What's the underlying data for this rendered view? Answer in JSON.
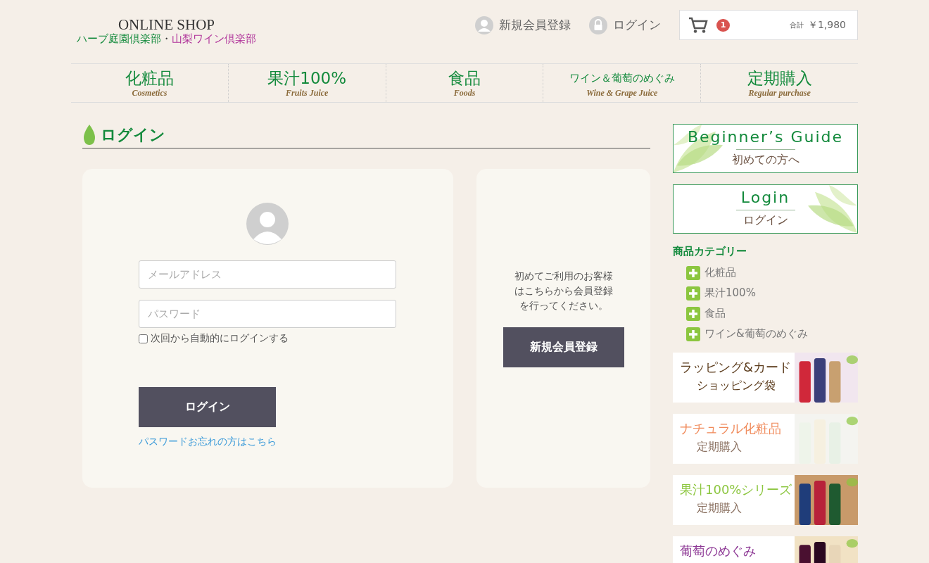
{
  "header": {
    "logo": "ONLINE SHOP",
    "clubs": [
      {
        "label": "ハーブ庭園倶楽部",
        "kind": "herb"
      },
      {
        "label": "・",
        "kind": "dot"
      },
      {
        "label": "山梨ワイン倶楽部",
        "kind": "wine"
      }
    ],
    "register_link": "新規会員登録",
    "login_link": "ログイン",
    "cart": {
      "count": "1",
      "total_label": "合計",
      "total": "￥1,980"
    }
  },
  "nav": [
    {
      "label": "化粧品",
      "sub": "Cosmetics"
    },
    {
      "label": "果汁100%",
      "sub": "Fruits Juice"
    },
    {
      "label": "食品",
      "sub": "Foods"
    },
    {
      "label": "ワイン＆葡萄のめぐみ",
      "sub": "Wine & Grape Juice"
    },
    {
      "label": "定期購入",
      "sub": "Regular purchase"
    }
  ],
  "page_title": "ログイン",
  "login_form": {
    "email": {
      "placeholder": "メールアドレス"
    },
    "password": {
      "placeholder": "パスワード"
    },
    "remember": {
      "label": "次回から自動的にログインする",
      "checked": false
    },
    "submit": "ログイン",
    "forgot_link": "パスワードお忘れの方はこちら"
  },
  "register_box": {
    "message": [
      "初めてご利用のお客様",
      "はこちらから会員登録",
      "を行ってください。"
    ],
    "button": "新規会員登録"
  },
  "sidebar": {
    "guide_banners": [
      {
        "title": "Beginner’s Guide",
        "subtitle": "初めての方へ",
        "kind": "leaf-left"
      },
      {
        "title": "Login",
        "subtitle": "ログイン",
        "kind": "leaf-right"
      }
    ],
    "category_heading": "商品カテゴリー",
    "categories": [
      "化粧品",
      "果汁100%",
      "食品",
      "ワイン&葡萄のめぐみ"
    ],
    "promo_banners": [
      {
        "lines": [
          "ラッピング&カード",
          "ショッピング袋"
        ],
        "kind": "wrapping"
      },
      {
        "lines": [
          "ナチュラル化粧品",
          "定期購入"
        ],
        "kind": "cosmetics"
      },
      {
        "lines": [
          "果汁100%シリーズ",
          "定期購入"
        ],
        "kind": "juice"
      },
      {
        "lines": [
          "葡萄のめぐみ"
        ],
        "kind": "grape"
      }
    ]
  }
}
